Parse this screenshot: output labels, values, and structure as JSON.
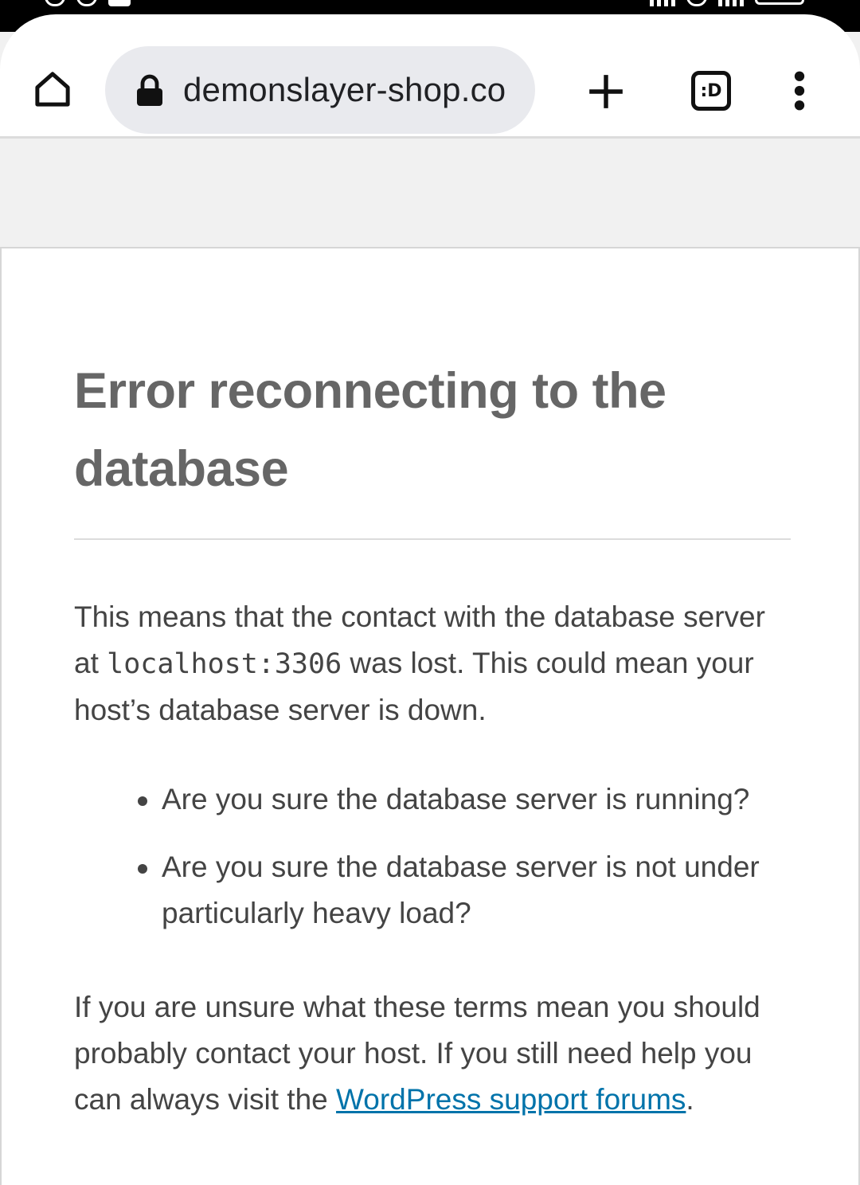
{
  "browser": {
    "url": "demonslayer-shop.co",
    "tab_count_label": ":D"
  },
  "error_page": {
    "title": "Error reconnecting to the database",
    "intro_before": "This means that the contact with the database server at ",
    "host": "localhost:3306",
    "intro_after": " was lost. This could mean your host’s database server is down.",
    "checks": [
      "Are you sure the database server is running?",
      "Are you sure the database server is not under particularly heavy load?"
    ],
    "help_before": "If you are unsure what these terms mean you should probably contact your host. If you still need help you can always visit the ",
    "help_link": "WordPress support forums",
    "help_after": "."
  },
  "colors": {
    "link": "#0073aa",
    "omnibox_bg": "#e9eaee",
    "page_bg": "#f1f1f1"
  },
  "icons": [
    "home-icon",
    "lock-icon",
    "plus-icon",
    "tab-switcher-icon",
    "more-vert-icon"
  ]
}
